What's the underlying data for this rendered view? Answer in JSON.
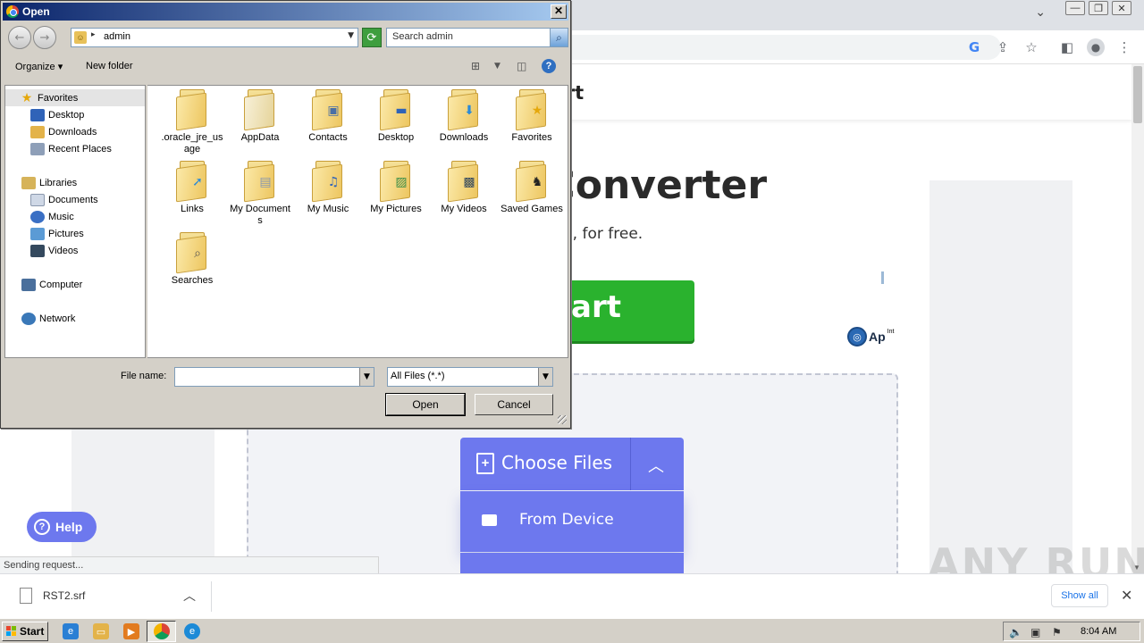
{
  "browser": {
    "window_buttons": {
      "minimize": "—",
      "restore": "❐",
      "close": "✕"
    },
    "tab_menu_icon": "chevron-down-icon",
    "toolbar_icons": [
      "google-icon",
      "share-icon",
      "star-icon",
      "side-panel-icon",
      "profile-icon",
      "menu-icon"
    ]
  },
  "page": {
    "brand": "Convert",
    "hero_title": "G Converter",
    "hero_subtitle": "PG online, for free.",
    "start_label": "tart",
    "ad_logo_text": "Ap",
    "ad_logo_sup": "Int",
    "choose_files_label": "Choose Files",
    "from_device_label": "From Device",
    "help_label": "Help",
    "status_text": "Sending request...",
    "watermark": "ANY RUN"
  },
  "dialog": {
    "title": "Open",
    "close_label": "✕",
    "address_path": "admin",
    "search_placeholder": "Search admin",
    "commands": {
      "organize": "Organize",
      "new_folder": "New folder"
    },
    "nav": {
      "favorites": "Favorites",
      "favorites_items": [
        "Desktop",
        "Downloads",
        "Recent Places"
      ],
      "libraries": "Libraries",
      "libraries_items": [
        "Documents",
        "Music",
        "Pictures",
        "Videos"
      ],
      "computer": "Computer",
      "network": "Network"
    },
    "files": [
      {
        "name": ".oracle_jre_usage",
        "icon": "folder-icon"
      },
      {
        "name": "AppData",
        "icon": "folder-icon"
      },
      {
        "name": "Contacts",
        "icon": "contacts-folder-icon"
      },
      {
        "name": "Desktop",
        "icon": "desktop-folder-icon"
      },
      {
        "name": "Downloads",
        "icon": "downloads-folder-icon"
      },
      {
        "name": "Favorites",
        "icon": "favorites-folder-icon"
      },
      {
        "name": "Links",
        "icon": "links-folder-icon"
      },
      {
        "name": "My Documents",
        "icon": "documents-folder-icon"
      },
      {
        "name": "My Music",
        "icon": "music-folder-icon"
      },
      {
        "name": "My Pictures",
        "icon": "pictures-folder-icon"
      },
      {
        "name": "My Videos",
        "icon": "videos-folder-icon"
      },
      {
        "name": "Saved Games",
        "icon": "saved-games-folder-icon"
      },
      {
        "name": "Searches",
        "icon": "searches-folder-icon"
      }
    ],
    "file_name_label": "File name:",
    "file_name_value": "",
    "file_type_filter": "All Files (*.*)",
    "open_button": "Open",
    "cancel_button": "Cancel"
  },
  "downloads_bar": {
    "file_name": "RST2.srf",
    "show_all": "Show all"
  },
  "taskbar": {
    "start_label": "Start",
    "clock": "8:04 AM"
  },
  "colors": {
    "accent_purple": "#6d78ee",
    "start_green": "#2ab22e",
    "dialog_face": "#d4d0c8",
    "title_blue": "#0a246a"
  }
}
